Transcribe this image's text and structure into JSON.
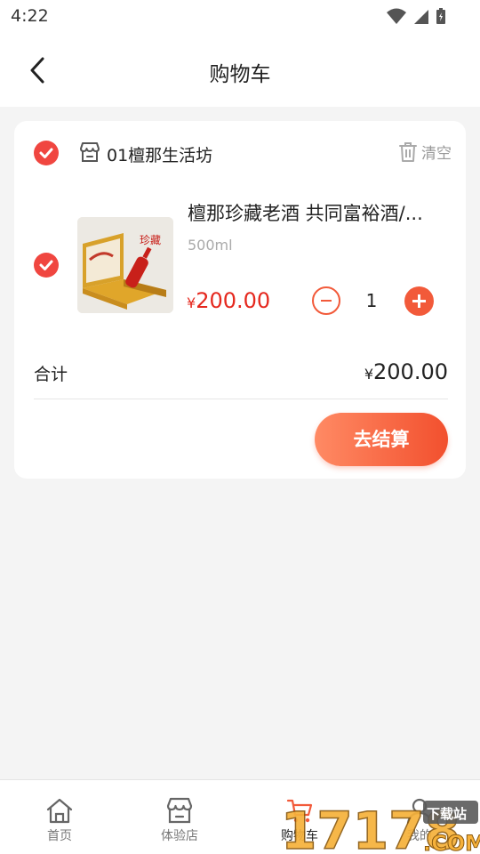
{
  "status_bar": {
    "time": "4:22"
  },
  "nav": {
    "title": "购物车"
  },
  "cart": {
    "shop_name": "01檀那生活坊",
    "clear_label": "清空",
    "items": [
      {
        "name": "檀那珍藏老酒 共同富裕酒/...",
        "spec": "500ml",
        "price_symbol": "¥",
        "price": "200.00",
        "quantity": "1"
      }
    ],
    "total_label": "合计",
    "total_symbol": "¥",
    "total_value": "200.00",
    "checkout_label": "去结算"
  },
  "tabbar": {
    "tabs": [
      {
        "label": "首页",
        "icon": "home-icon"
      },
      {
        "label": "体验店",
        "icon": "store-icon"
      },
      {
        "label": "购物车",
        "icon": "cart-icon"
      },
      {
        "label": "我的",
        "icon": "profile-icon"
      }
    ]
  },
  "watermark": {
    "text": "17178",
    "suffix": "下载站",
    "domain": ".COM"
  },
  "colors": {
    "accent": "#f25a3a",
    "check": "#f04640",
    "price": "#e5281e"
  }
}
